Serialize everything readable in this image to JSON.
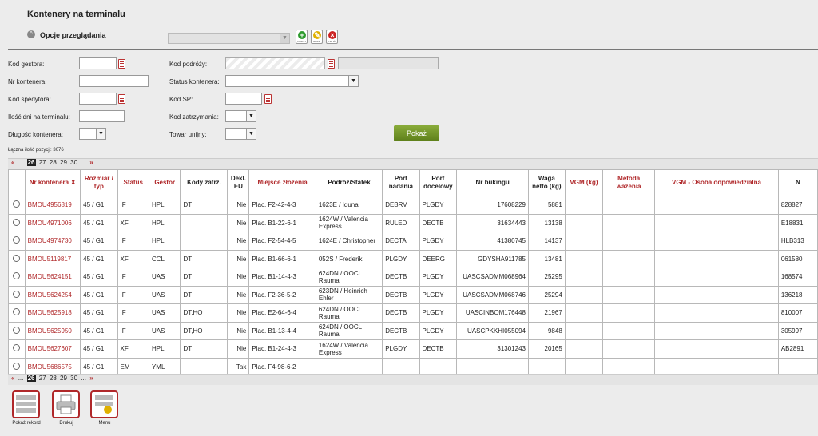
{
  "header": {
    "title": "Kontenery na terminalu",
    "view_options_label": "Opcje przeglądania"
  },
  "toolbar": {
    "add_label": "DODAJ",
    "edit_label": "ZMIEŃ",
    "delete_label": "USUŃ"
  },
  "filters": {
    "kod_gestora": "Kod gestora:",
    "nr_kontenera": "Nr kontenera:",
    "kod_spedytora": "Kod spedytora:",
    "ilosc_dni": "Ilość dni na terminalu:",
    "dlugosc": "Długość kontenera:",
    "kod_podrozy": "Kod podróży:",
    "status": "Status kontenera:",
    "kod_sp": "Kod SP:",
    "kod_zatrzymania": "Kod zatrzymania:",
    "towar_unijny": "Towar unijny:",
    "show_button": "Pokaż"
  },
  "summary": {
    "total": "Łączna ilość pozycji: 3076"
  },
  "pager": {
    "prev": "«",
    "ellipsis": "...",
    "current": "26",
    "pages": [
      "27",
      "28",
      "29",
      "30",
      "..."
    ],
    "next": "»"
  },
  "columns": [
    "Nr kontenera",
    "Rozmiar / typ",
    "Status",
    "Gestor",
    "Kody zatrz.",
    "Dekl. EU",
    "Miejsce złożenia",
    "Podróż/Statek",
    "Port nadania",
    "Port docelowy",
    "Nr bukingu",
    "Waga netto (kg)",
    "VGM (kg)",
    "Metoda ważenia",
    "VGM - Osoba odpowiedzialna",
    "N"
  ],
  "rows": [
    [
      "BMOU4956819",
      "45 / G1",
      "IF",
      "HPL",
      "DT",
      "Nie",
      "Plac. F2-42-4-3",
      "1623E / Iduna",
      "DEBRV",
      "PLGDY",
      "17608229",
      "5881",
      "",
      "",
      "",
      "828827"
    ],
    [
      "BMOU4971006",
      "45 / G1",
      "XF",
      "HPL",
      "",
      "Nie",
      "Plac. B1-22-6-1",
      "1624W / Valencia Express",
      "RULED",
      "DECTB",
      "31634443",
      "13138",
      "",
      "",
      "",
      "E18831"
    ],
    [
      "BMOU4974730",
      "45 / G1",
      "IF",
      "HPL",
      "",
      "Nie",
      "Plac. F2-54-4-5",
      "1624E / Christopher",
      "DECTA",
      "PLGDY",
      "41380745",
      "14137",
      "",
      "",
      "",
      "HLB313"
    ],
    [
      "BMOU5119817",
      "45 / G1",
      "XF",
      "CCL",
      "DT",
      "Nie",
      "Plac. B1-66-6-1",
      "052S / Frederik",
      "PLGDY",
      "DEERG",
      "GDYSHA911785",
      "13481",
      "",
      "",
      "",
      "061580"
    ],
    [
      "BMOU5624151",
      "45 / G1",
      "IF",
      "UAS",
      "DT",
      "Nie",
      "Plac. B1-14-4-3",
      "624DN / OOCL Rauma",
      "DECTB",
      "PLGDY",
      "UASCSADMM068964",
      "25295",
      "",
      "",
      "",
      "168574"
    ],
    [
      "BMOU5624254",
      "45 / G1",
      "IF",
      "UAS",
      "DT",
      "Nie",
      "Plac. F2-36-5-2",
      "623DN / Heinrich Ehler",
      "DECTB",
      "PLGDY",
      "UASCSADMM068746",
      "25294",
      "",
      "",
      "",
      "136218"
    ],
    [
      "BMOU5625918",
      "45 / G1",
      "IF",
      "UAS",
      "DT,HO",
      "Nie",
      "Plac. E2-64-6-4",
      "624DN / OOCL Rauma",
      "DECTB",
      "PLGDY",
      "UASCINBOM176448",
      "21967",
      "",
      "",
      "",
      "810007"
    ],
    [
      "BMOU5625950",
      "45 / G1",
      "IF",
      "UAS",
      "DT,HO",
      "Nie",
      "Plac. B1-13-4-4",
      "624DN / OOCL Rauma",
      "DECTB",
      "PLGDY",
      "UASCPKKHI055094",
      "9848",
      "",
      "",
      "",
      "305997"
    ],
    [
      "BMOU5627607",
      "45 / G1",
      "XF",
      "HPL",
      "DT",
      "Nie",
      "Plac. B1-24-4-3",
      "1624W / Valencia Express",
      "PLGDY",
      "DECTB",
      "31301243",
      "20165",
      "",
      "",
      "",
      "AB2891"
    ],
    [
      "BMOU5686575",
      "45 / G1",
      "EM",
      "YML",
      "",
      "Tak",
      "Plac. F4-98-6-2",
      "",
      "",
      "",
      "",
      "",
      "",
      "",
      "",
      ""
    ]
  ],
  "bottom": {
    "show_record": "Pokaż rekord",
    "print": "Drukuj",
    "menu": "Menu"
  }
}
